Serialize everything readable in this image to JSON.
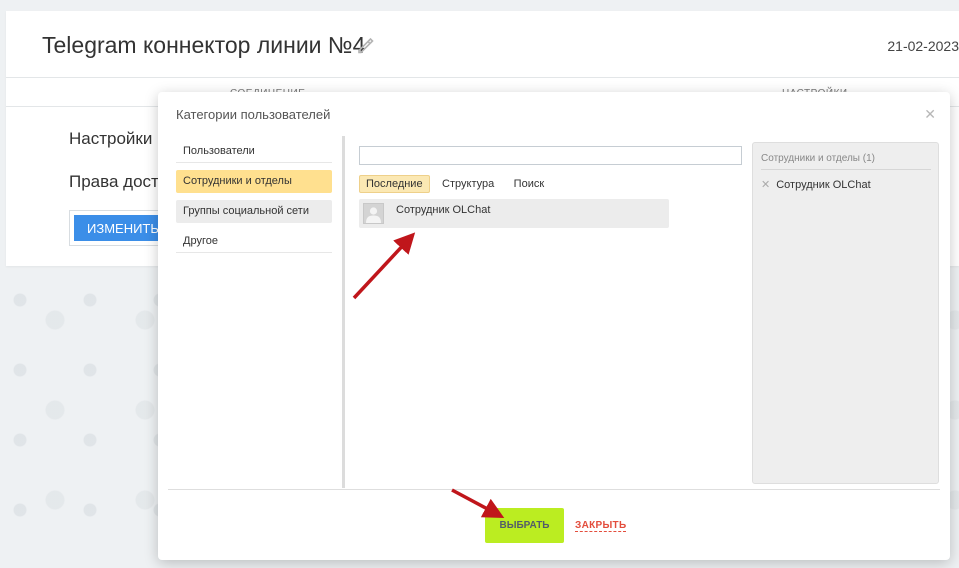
{
  "page": {
    "title": "Telegram коннектор линии №4",
    "date": "21-02-2023",
    "tabs": [
      "СОЕДИНЕНИЕ",
      "НАСТРОЙКИ"
    ],
    "settings_label": "Настройки",
    "rights_label": "Права дост",
    "edit_button": "ИЗМЕНИТЬ"
  },
  "dialog": {
    "title": "Категории пользователей",
    "categories": [
      {
        "label": "Пользователи"
      },
      {
        "label": "Сотрудники и отделы"
      },
      {
        "label": "Группы социальной сети"
      },
      {
        "label": "Другое"
      }
    ],
    "search_value": "",
    "sub_tabs": [
      "Последние",
      "Структура",
      "Поиск"
    ],
    "results": [
      {
        "name": "Сотрудник OLChat"
      }
    ],
    "selected": {
      "header": "Сотрудники и отделы (1)",
      "items": [
        {
          "name": "Сотрудник OLChat"
        }
      ]
    },
    "select_button": "ВЫБРАТЬ",
    "close_link": "ЗАКРЫТЬ"
  },
  "colors": {
    "select_button": "#bbed21",
    "active_category": "#ffe08f",
    "edit_button": "#3b8ee8",
    "close_link": "#e34d3c",
    "annotation_arrow": "#c0161b"
  }
}
